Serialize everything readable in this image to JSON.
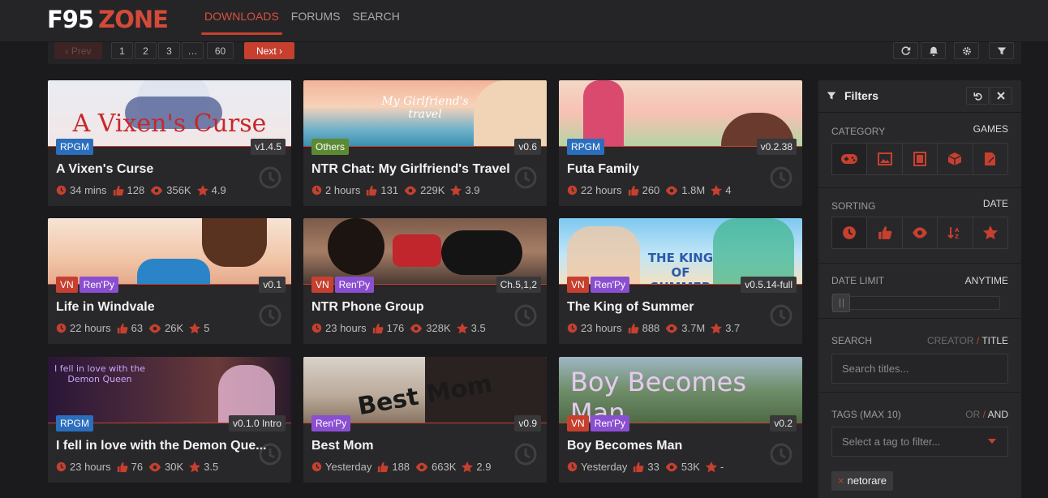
{
  "logo": {
    "left": "F95",
    "right": "ZONE"
  },
  "nav": [
    "DOWNLOADS",
    "FORUMS",
    "SEARCH"
  ],
  "pagination": {
    "prev": "‹ Prev",
    "pages": [
      "1",
      "2",
      "3",
      "…",
      "60"
    ],
    "next": "Next ›"
  },
  "colors": {
    "accent": "#c7402f",
    "rpgm": "#2a6ebd",
    "others": "#5b8a33",
    "vn": "#c7402f",
    "renpy": "#8a4fd1"
  },
  "cards": [
    {
      "title": "A Vixen's Curse",
      "thumb_text": "A Vixen's Curse",
      "tags": [
        "RPGM"
      ],
      "version": "v1.4.5",
      "time": "34 mins",
      "likes": "128",
      "views": "356K",
      "rating": "4.9"
    },
    {
      "title": "NTR Chat: My Girlfriend's Travel",
      "thumb_text": "My Girlfriend's travel",
      "tags": [
        "Others"
      ],
      "version": "v0.6",
      "time": "2 hours",
      "likes": "131",
      "views": "229K",
      "rating": "3.9"
    },
    {
      "title": "Futa Family",
      "thumb_text": "",
      "tags": [
        "RPGM"
      ],
      "version": "v0.2.38",
      "time": "22 hours",
      "likes": "260",
      "views": "1.8M",
      "rating": "4"
    },
    {
      "title": "Life in Windvale",
      "thumb_text": "",
      "tags": [
        "VN",
        "Ren'Py"
      ],
      "version": "v0.1",
      "time": "22 hours",
      "likes": "63",
      "views": "26K",
      "rating": "5"
    },
    {
      "title": "NTR Phone Group",
      "thumb_text": "",
      "tags": [
        "VN",
        "Ren'Py"
      ],
      "version": "Ch.5,1,2",
      "time": "23 hours",
      "likes": "176",
      "views": "328K",
      "rating": "3.5"
    },
    {
      "title": "The King of Summer",
      "thumb_text": "THE KING OF SUMMER",
      "tags": [
        "VN",
        "Ren'Py"
      ],
      "version": "v0.5.14-full",
      "time": "23 hours",
      "likes": "888",
      "views": "3.7M",
      "rating": "3.7"
    },
    {
      "title": "I fell in love with the Demon Que...",
      "thumb_text": "I fell in love with the Demon Queen",
      "tags": [
        "RPGM"
      ],
      "version": "v0.1.0 Intro",
      "time": "23 hours",
      "likes": "76",
      "views": "30K",
      "rating": "3.5"
    },
    {
      "title": "Best Mom",
      "thumb_text": "Best Mom",
      "tags": [
        "Ren'Py"
      ],
      "version": "v0.9",
      "time": "Yesterday",
      "likes": "188",
      "views": "663K",
      "rating": "2.9"
    },
    {
      "title": "Boy Becomes Man",
      "thumb_text": "Boy Becomes Man",
      "tags": [
        "VN",
        "Ren'Py"
      ],
      "version": "v0.2",
      "time": "Yesterday",
      "likes": "33",
      "views": "53K",
      "rating": "-"
    }
  ],
  "filters": {
    "title": "Filters",
    "category": {
      "label": "CATEGORY",
      "value": "GAMES"
    },
    "sorting": {
      "label": "SORTING",
      "value": "DATE"
    },
    "date_limit": {
      "label": "DATE LIMIT",
      "value": "ANYTIME"
    },
    "search": {
      "label": "SEARCH",
      "mode_a": "CREATOR",
      "sep": "/",
      "mode_b": "TITLE",
      "placeholder": "Search titles..."
    },
    "tags": {
      "label": "TAGS (MAX 10)",
      "mode_a": "OR",
      "sep": "/",
      "mode_b": "AND",
      "placeholder": "Select a tag to filter...",
      "selected": [
        "netorare"
      ]
    }
  }
}
